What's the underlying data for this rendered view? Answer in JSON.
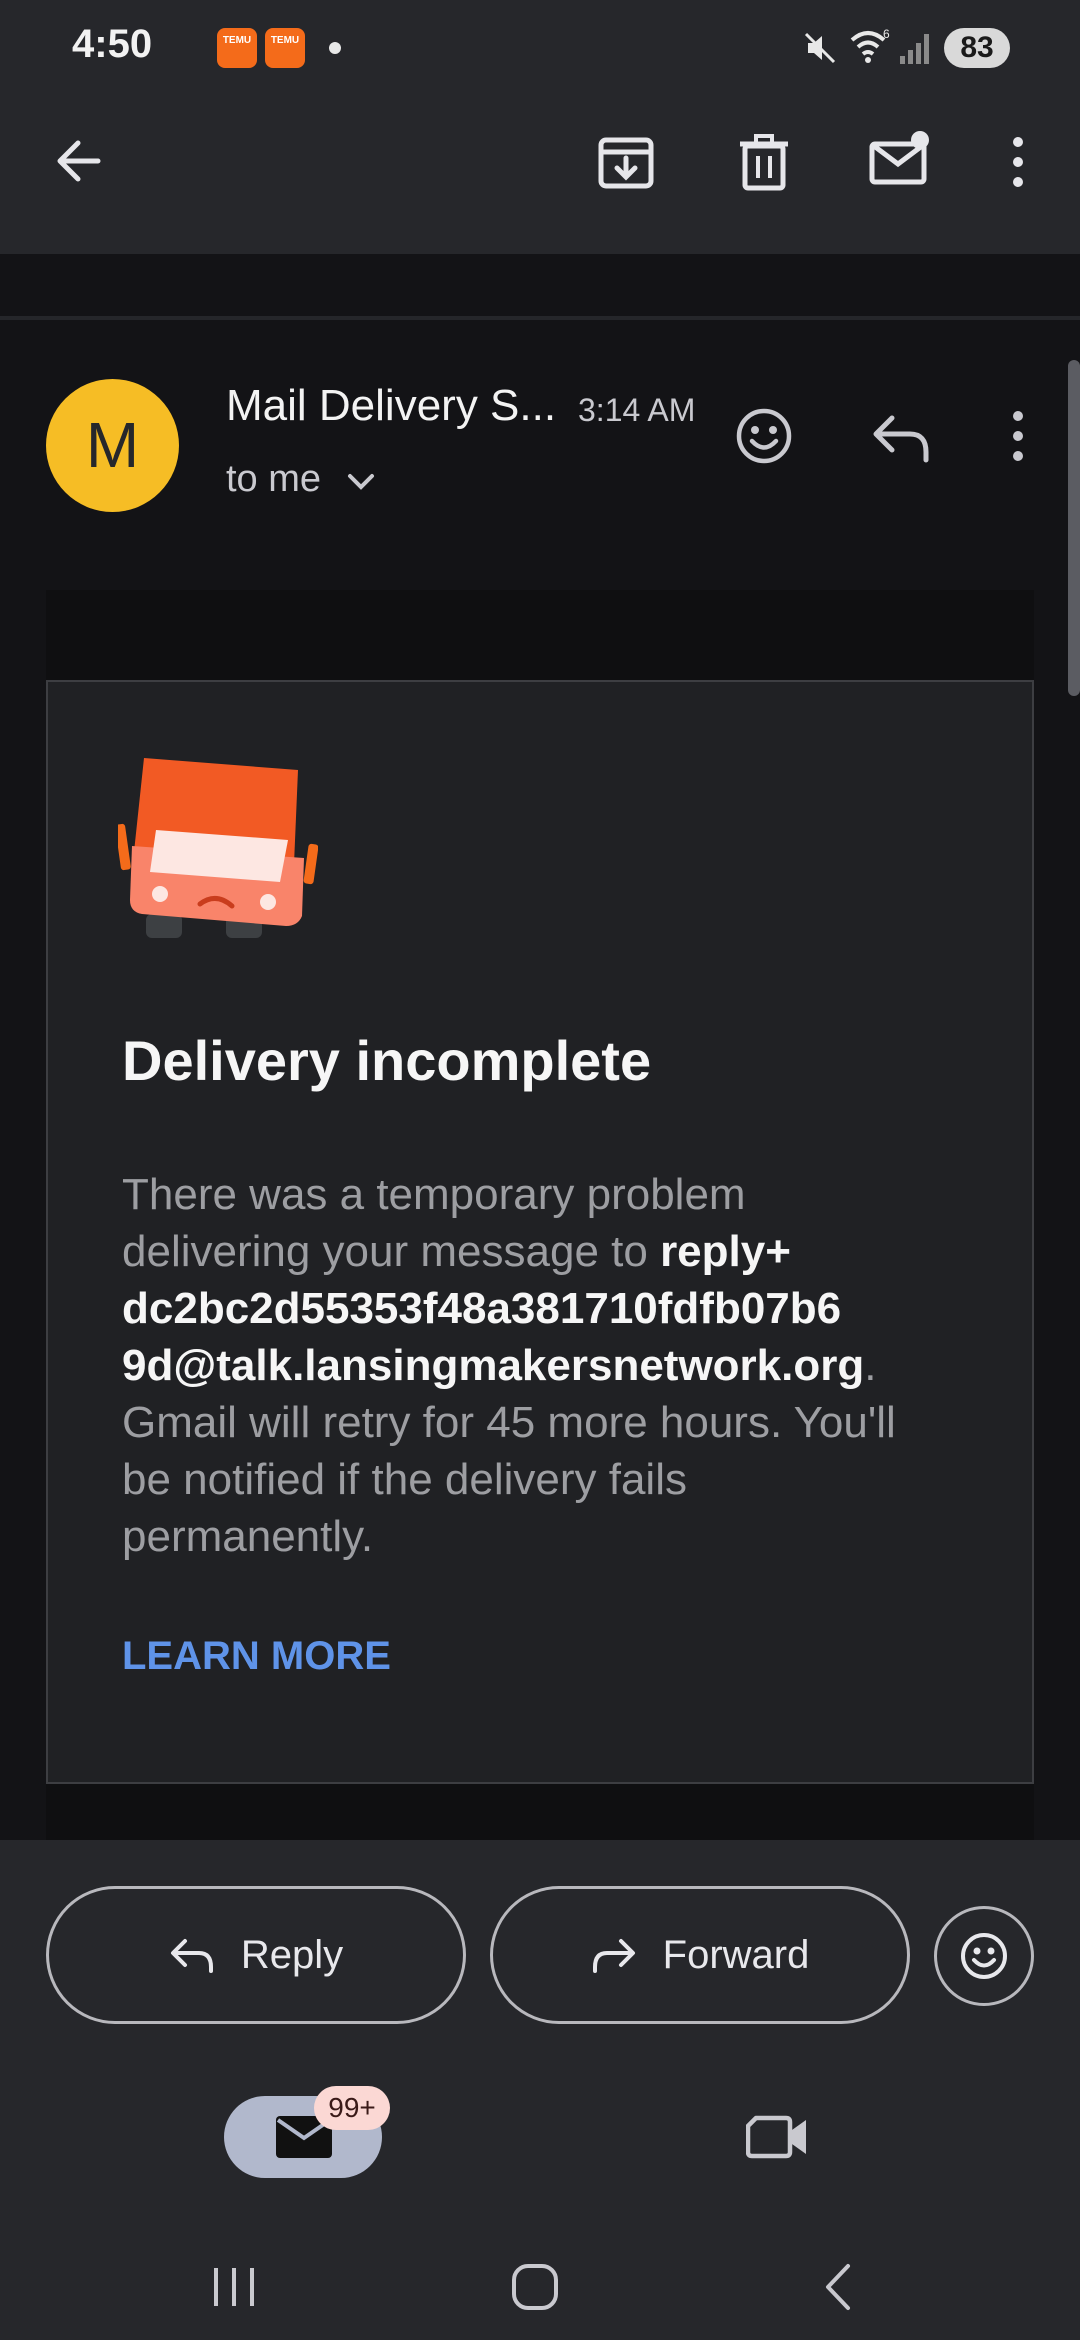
{
  "status_bar": {
    "time": "4:50",
    "app_icons": [
      "TEMU",
      "TEMU"
    ],
    "battery": "83",
    "icons": [
      "mute-icon",
      "wifi-icon",
      "signal-icon"
    ]
  },
  "toolbar": {
    "icons": [
      "back-arrow-icon",
      "archive-icon",
      "delete-icon",
      "mark-unread-icon",
      "more-vert-icon"
    ]
  },
  "message": {
    "avatar_letter": "M",
    "sender": "Mail Delivery S...",
    "time": "3:14 AM",
    "recipient": "to me"
  },
  "email": {
    "title": "Delivery incomplete",
    "text_1": "There was a temporary problem delivering your message to ",
    "address": "reply+ dc2bc2d55353f48a381710fdfb07b6 9d@talk.lansingmakersnetwork.org",
    "text_2": ". Gmail will retry for 45 more hours. You'll be notified if the delivery fails permanently.",
    "link": "LEARN MORE"
  },
  "actions": {
    "reply": "Reply",
    "forward": "Forward"
  },
  "bottom_nav": {
    "mail_badge": "99+"
  },
  "colors": {
    "background": "#131316",
    "surface": "#26272b",
    "card": "#202124",
    "avatar": "#f6bd25",
    "link": "#5f93e8",
    "truck": "#f25a24",
    "badge": "#fbd8d4"
  }
}
